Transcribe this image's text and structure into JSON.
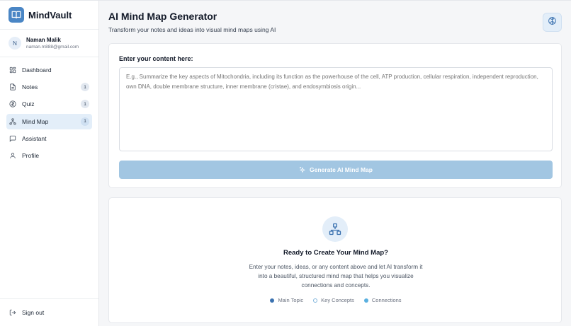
{
  "app": {
    "name": "MindVault",
    "accent": "#4a86c5"
  },
  "user": {
    "initial": "N",
    "name": "Naman Malik",
    "email": "naman.m888@gmail.com"
  },
  "sidebar": {
    "items": [
      {
        "label": "Dashboard",
        "icon": "dashboard-icon",
        "badge": ""
      },
      {
        "label": "Notes",
        "icon": "notes-icon",
        "badge": "1"
      },
      {
        "label": "Quiz",
        "icon": "quiz-icon",
        "badge": "1"
      },
      {
        "label": "Mind Map",
        "icon": "mindmap-icon",
        "badge": "1",
        "active": true
      },
      {
        "label": "Assistant",
        "icon": "chat-icon",
        "badge": ""
      },
      {
        "label": "Profile",
        "icon": "user-icon",
        "badge": ""
      }
    ],
    "signout_label": "Sign out"
  },
  "header": {
    "title": "AI Mind Map Generator",
    "subtitle": "Transform your notes and ideas into visual mind maps using AI"
  },
  "input_card": {
    "label": "Enter your content here:",
    "placeholder": "E.g., Summarize the key aspects of Mitochondria, including its function as the powerhouse of the cell, ATP production, cellular respiration, independent reproduction, own DNA, double membrane structure, inner membrane (cristae), and endosymbiosis origin...",
    "value": "",
    "button_label": "Generate AI Mind Map"
  },
  "empty_state": {
    "title": "Ready to Create Your Mind Map?",
    "description": "Enter your notes, ideas, or any content above and let AI transform it into a beautiful, structured mind map that helps you visualize connections and concepts.",
    "legend": [
      {
        "label": "Main Topic",
        "color": "#3b72b0",
        "style": "filled"
      },
      {
        "label": "Key Concepts",
        "color": "#7fb4dc",
        "style": "outline"
      },
      {
        "label": "Connections",
        "color": "#5ab0e0",
        "style": "filled"
      }
    ]
  }
}
